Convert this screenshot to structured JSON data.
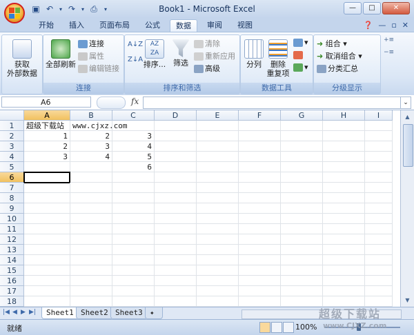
{
  "window": {
    "title": "Book1 - Microsoft Excel"
  },
  "tabs": [
    "开始",
    "插入",
    "页面布局",
    "公式",
    "数据",
    "审阅",
    "视图"
  ],
  "ribbon": {
    "get_external": "获取\n外部数据",
    "connections": {
      "refresh_all": "全部刷新",
      "connections": "连接",
      "properties": "属性",
      "edit_links": "编辑链接",
      "group": "连接"
    },
    "sort_filter": {
      "sort": "排序...",
      "filter": "筛选",
      "clear": "清除",
      "reapply": "重新应用",
      "advanced": "高级",
      "group": "排序和筛选"
    },
    "data_tools": {
      "text_to_columns": "分列",
      "remove_duplicates": "删除\n重复项",
      "group": "数据工具"
    },
    "outline": {
      "group_btn": "组合",
      "ungroup": "取消组合",
      "subtotal": "分类汇总",
      "group": "分级显示"
    }
  },
  "formula_bar": {
    "name_box": "A6",
    "fx": "fx",
    "content": ""
  },
  "grid": {
    "columns": [
      "A",
      "B",
      "C",
      "D",
      "E",
      "F",
      "G",
      "H",
      "I"
    ],
    "rows": [
      "1",
      "2",
      "3",
      "4",
      "5",
      "6",
      "7",
      "8",
      "9",
      "10",
      "11",
      "12",
      "13",
      "14",
      "15",
      "16",
      "17",
      "18"
    ],
    "active_cell": "A6",
    "cells": {
      "A1": "超级下载站",
      "B1": "www.cjxz.com",
      "A2": "1",
      "B2": "2",
      "C2": "3",
      "A3": "2",
      "B3": "3",
      "C3": "4",
      "A4": "3",
      "B4": "4",
      "C4": "5",
      "C5": "6"
    }
  },
  "sheets": [
    "Sheet1",
    "Sheet2",
    "Sheet3"
  ],
  "status": {
    "ready": "就绪",
    "zoom": "100%"
  },
  "watermark": {
    "brand": "超级下载站",
    "url": "www.CJXZ.com"
  }
}
